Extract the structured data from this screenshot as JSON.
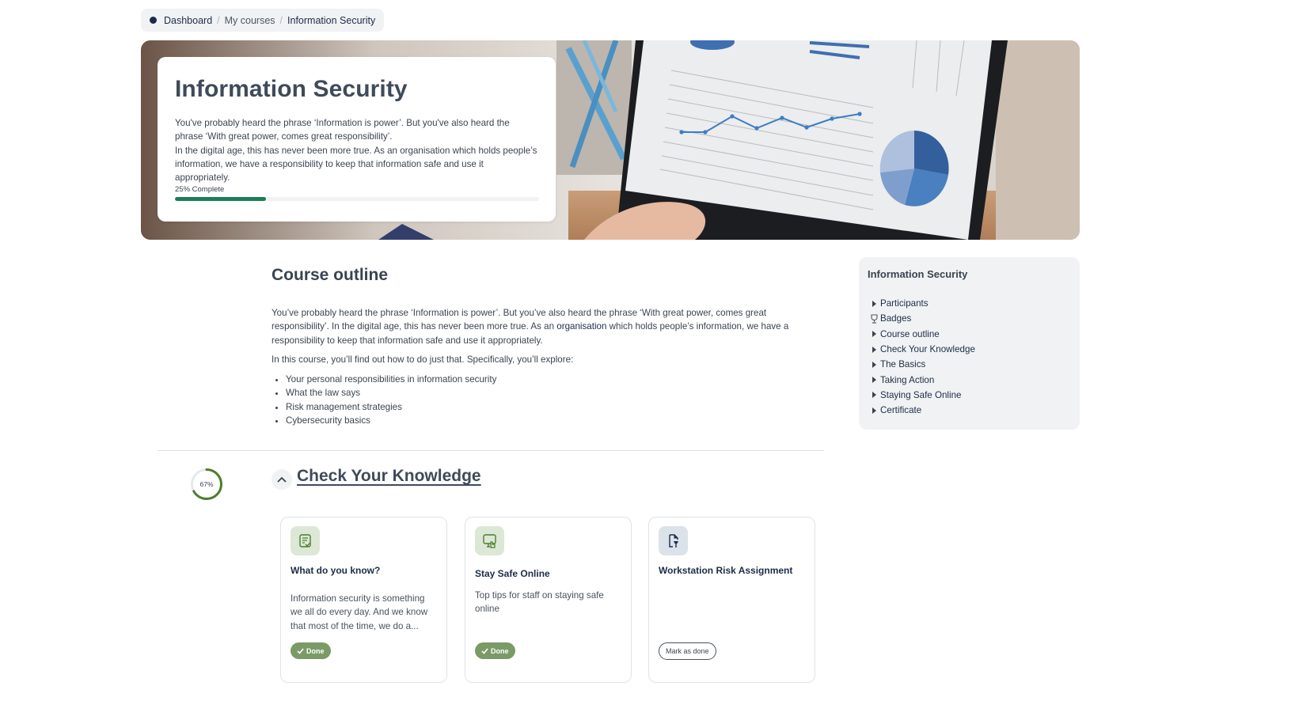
{
  "breadcrumb": {
    "items": [
      {
        "label": "Dashboard"
      },
      {
        "label": "My courses"
      },
      {
        "label": "Information Security"
      }
    ],
    "separator": "/"
  },
  "hero": {
    "title": "Information Security",
    "description_lines": [
      "You've probably heard the phrase ‘Information is power’. But you've also heard the phrase ‘With great power, comes great responsibility’.",
      "In the digital age, this has never been more true. As an organisation which holds people’s information, we have a responsibility to keep that information safe and use it appropriately."
    ],
    "progress_label": "25% Complete",
    "progress_percent": 25,
    "progress_color": "#1a7f55",
    "image_description": "laptop screen showing line chart, bar chart and pie chart"
  },
  "course_outline": {
    "title": "Course outline",
    "paragraph1_before_link": "You’ve probably heard the phrase ‘Information is power’. But you’ve also heard the phrase ‘With great power, comes great responsibility’. In the digital age, this has never been more true. As an ",
    "paragraph1_link": "organisation",
    "paragraph1_after_link": " which holds people’s information, we have a responsibility to keep that information safe and use it appropriately.",
    "paragraph2": "In this course, you’ll find out how to do just that. Specifically, you’ll explore:",
    "bullets": [
      "Your personal responsibilities in information security",
      "What the law says",
      "Risk management strategies",
      "Cybersecurity basics"
    ]
  },
  "section": {
    "title": "Check Your Knowledge",
    "progress_label": "67%",
    "progress_percent": 67,
    "progress_color": "#4a7f2e",
    "collapse_icon": "chevron-up-icon",
    "activities": [
      {
        "icon": "quiz-icon",
        "title": "What do you know?",
        "description": "Information security is something we all do every day. And we know that most of the time, we do a...",
        "status": "Done"
      },
      {
        "icon": "lesson-screen-icon",
        "title": "Stay Safe Online",
        "description": "Top tips for staff on staying safe online",
        "status": "Done"
      },
      {
        "icon": "assignment-icon",
        "title": "Workstation Risk Assignment",
        "description": "",
        "action": "Mark as done"
      }
    ]
  },
  "sidebar": {
    "title": "Information Security",
    "items": [
      {
        "label": "Participants",
        "icon": "triangle-right-icon"
      },
      {
        "label": "Badges",
        "icon": "trophy-icon"
      },
      {
        "label": "Course outline",
        "icon": "triangle-right-icon"
      },
      {
        "label": "Check Your Knowledge",
        "icon": "triangle-right-icon"
      },
      {
        "label": "The Basics",
        "icon": "triangle-right-icon"
      },
      {
        "label": "Taking Action",
        "icon": "triangle-right-icon"
      },
      {
        "label": "Staying Safe Online",
        "icon": "triangle-right-icon"
      },
      {
        "label": "Certificate",
        "icon": "triangle-right-icon"
      }
    ]
  }
}
